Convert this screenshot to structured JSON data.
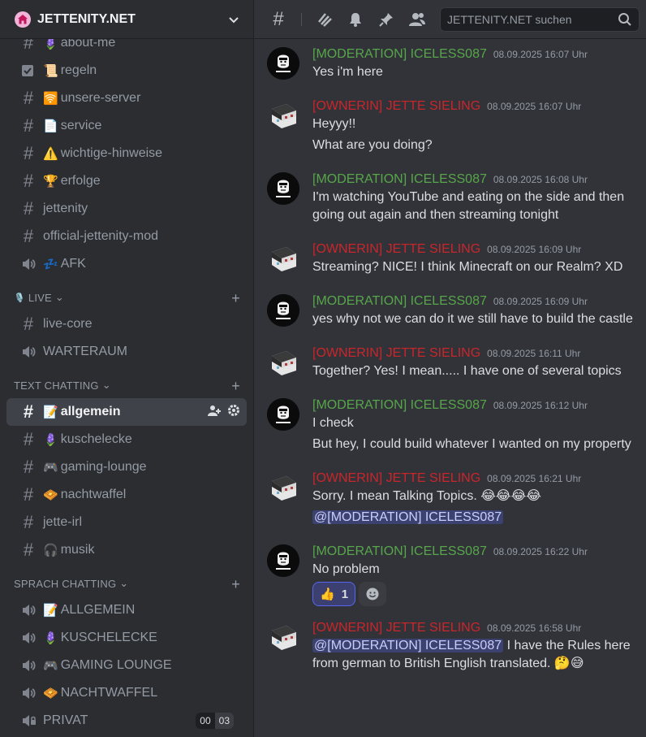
{
  "server": {
    "name": "JETTENITY.NET"
  },
  "channels_top": [
    {
      "type": "text",
      "emoji": "🪻",
      "name": "about-me",
      "partial": true
    },
    {
      "type": "rules",
      "emoji": "📜",
      "name": "regeln"
    },
    {
      "type": "text",
      "emoji": "🛜",
      "name": "unsere-server"
    },
    {
      "type": "text",
      "emoji": "📄",
      "name": "service"
    },
    {
      "type": "text",
      "emoji": "⚠️",
      "name": "wichtige-hinweise"
    },
    {
      "type": "text",
      "emoji": "🏆",
      "name": "erfolge"
    },
    {
      "type": "text",
      "emoji": "",
      "name": "jettenity"
    },
    {
      "type": "text",
      "emoji": "",
      "name": "official-jettenity-mod"
    },
    {
      "type": "voice",
      "emoji": "💤",
      "name": "AFK"
    }
  ],
  "categories": [
    {
      "name": "LIVE",
      "icon": "🎙️",
      "channels": [
        {
          "type": "text",
          "emoji": "",
          "name": "live-core"
        },
        {
          "type": "voice",
          "emoji": "",
          "name": "WARTERAUM"
        }
      ]
    },
    {
      "name": "TEXT CHATTING",
      "icon": "",
      "channels": [
        {
          "type": "text",
          "emoji": "📝",
          "name": "allgemein",
          "active": true
        },
        {
          "type": "text",
          "emoji": "🪻",
          "name": "kuschelecke"
        },
        {
          "type": "text",
          "emoji": "🎮",
          "name": "gaming-lounge"
        },
        {
          "type": "text",
          "emoji": "🧇",
          "name": "nachtwaffel"
        },
        {
          "type": "text",
          "emoji": "",
          "name": "jette-irl"
        },
        {
          "type": "text",
          "emoji": "🎧",
          "name": "musik"
        }
      ]
    },
    {
      "name": "SPRACH CHATTING",
      "icon": "",
      "channels": [
        {
          "type": "voice",
          "emoji": "📝",
          "name": "ALLGEMEIN"
        },
        {
          "type": "voice",
          "emoji": "🪻",
          "name": "KUSCHELECKE"
        },
        {
          "type": "voice",
          "emoji": "🎮",
          "name": "GAMING LOUNGE"
        },
        {
          "type": "voice",
          "emoji": "🧇",
          "name": "NACHTWAFFEL"
        },
        {
          "type": "voice-locked",
          "emoji": "",
          "name": "PRIVAT",
          "badges": [
            "00",
            "03"
          ]
        }
      ]
    }
  ],
  "search": {
    "placeholder": "JETTENITY.NET suchen"
  },
  "messages": [
    {
      "role": "mod",
      "author": "[MODERATION] ICELESS087",
      "time": "08.09.2025 16:07 Uhr",
      "lines": [
        "Yes i'm here"
      ]
    },
    {
      "role": "own",
      "author": "[OWNERIN] JETTE SIELING",
      "time": "08.09.2025 16:07 Uhr",
      "lines": [
        "Heyyy!!",
        "What are you doing?"
      ]
    },
    {
      "role": "mod",
      "author": "[MODERATION] ICELESS087",
      "time": "08.09.2025 16:08 Uhr",
      "lines": [
        "I'm watching YouTube and eating on the side and then going out again and then streaming tonight"
      ]
    },
    {
      "role": "own",
      "author": "[OWNERIN] JETTE SIELING",
      "time": "08.09.2025 16:09 Uhr",
      "lines": [
        "Streaming? NICE! I think Minecraft on our Realm? XD"
      ]
    },
    {
      "role": "mod",
      "author": "[MODERATION] ICELESS087",
      "time": "08.09.2025 16:09 Uhr",
      "lines": [
        "yes why not we can do it we still have to build the castle"
      ]
    },
    {
      "role": "own",
      "author": "[OWNERIN] JETTE SIELING",
      "time": "08.09.2025 16:11 Uhr",
      "lines": [
        "Together? Yes! I mean..... I have one of several topics"
      ]
    },
    {
      "role": "mod",
      "author": "[MODERATION] ICELESS087",
      "time": "08.09.2025 16:12 Uhr",
      "lines": [
        "I check",
        "But hey, I could build whatever I wanted on my property"
      ]
    },
    {
      "role": "own",
      "author": "[OWNERIN] JETTE SIELING",
      "time": "08.09.2025 16:21 Uhr",
      "lines": [
        "Sorry. I mean Talking Topics. 😂😂😂😂"
      ],
      "mention_line": "@[MODERATION] ICELESS087"
    },
    {
      "role": "mod",
      "author": "[MODERATION] ICELESS087",
      "time": "08.09.2025 16:22 Uhr",
      "lines": [
        "No problem"
      ],
      "reaction": {
        "emoji": "👍",
        "count": "1"
      }
    },
    {
      "role": "own",
      "author": "[OWNERIN] JETTE SIELING",
      "time": "08.09.2025 16:58 Uhr",
      "mention": "@[MODERATION] ICELESS087",
      "text": " I have the Rules here from german to British English translated. 🤔😅"
    }
  ],
  "colors": {
    "mod": "#57a64a",
    "owner": "#c9262b",
    "mention_bg": "#3c4270"
  }
}
